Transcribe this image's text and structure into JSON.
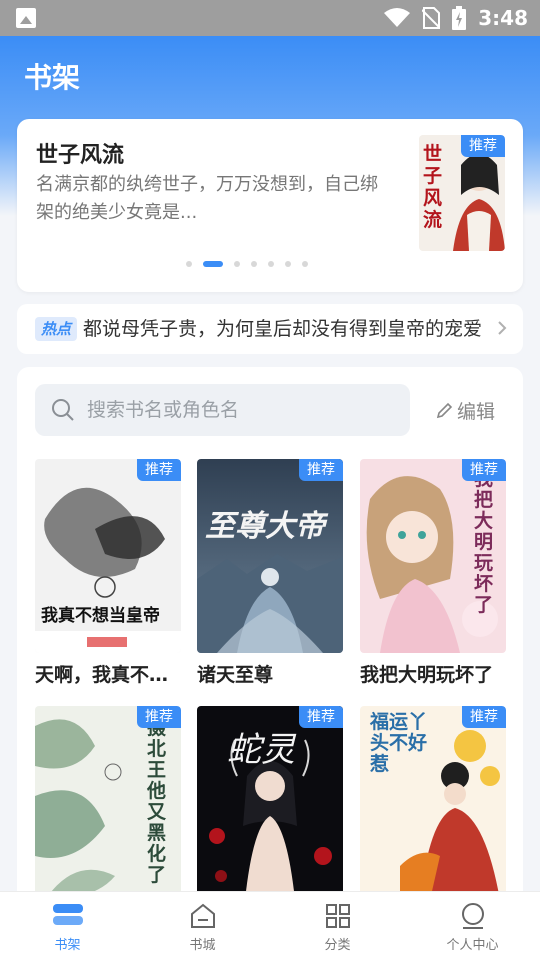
{
  "status_bar": {
    "time": "3:48"
  },
  "header": {
    "title": "书架"
  },
  "featured": {
    "title": "世子风流",
    "description": "名满京都的纨绔世子，万万没想到，自己绑架的绝美少女竟是...",
    "badge": "推荐",
    "cover_text": "世子风流",
    "carousel": {
      "count": 7,
      "active_index": 1
    }
  },
  "hot": {
    "badge": "热点",
    "text": "都说母凭子贵，为何皇后却没有得到皇帝的宠爱"
  },
  "shelf": {
    "search_placeholder": "搜索书名或角色名",
    "edit_label": "编辑",
    "books": [
      {
        "title": "天啊，我真不想当皇帝",
        "badge": "推荐",
        "cover_text": "我真不想当皇帝"
      },
      {
        "title": "诸天至尊",
        "badge": "推荐",
        "cover_text": "至尊大帝"
      },
      {
        "title": "我把大明玩坏了",
        "badge": "推荐",
        "cover_text": "我把大明玩坏了"
      },
      {
        "title": "",
        "badge": "推荐",
        "cover_text": "摄北王他又黑化了"
      },
      {
        "title": "",
        "badge": "推荐",
        "cover_text": "蛇灵"
      },
      {
        "title": "",
        "badge": "推荐",
        "cover_text": "福运丫头不好惹"
      }
    ]
  },
  "tabbar": {
    "items": [
      {
        "label": "书架",
        "icon": "bookshelf-icon",
        "active": true
      },
      {
        "label": "书城",
        "icon": "bookstore-icon",
        "active": false
      },
      {
        "label": "分类",
        "icon": "category-grid-icon",
        "active": false
      },
      {
        "label": "个人中心",
        "icon": "profile-icon",
        "active": false
      }
    ]
  },
  "colors": {
    "accent": "#3b8df6",
    "status_bar": "#9e9e9e",
    "background": "#f3f5f9"
  }
}
